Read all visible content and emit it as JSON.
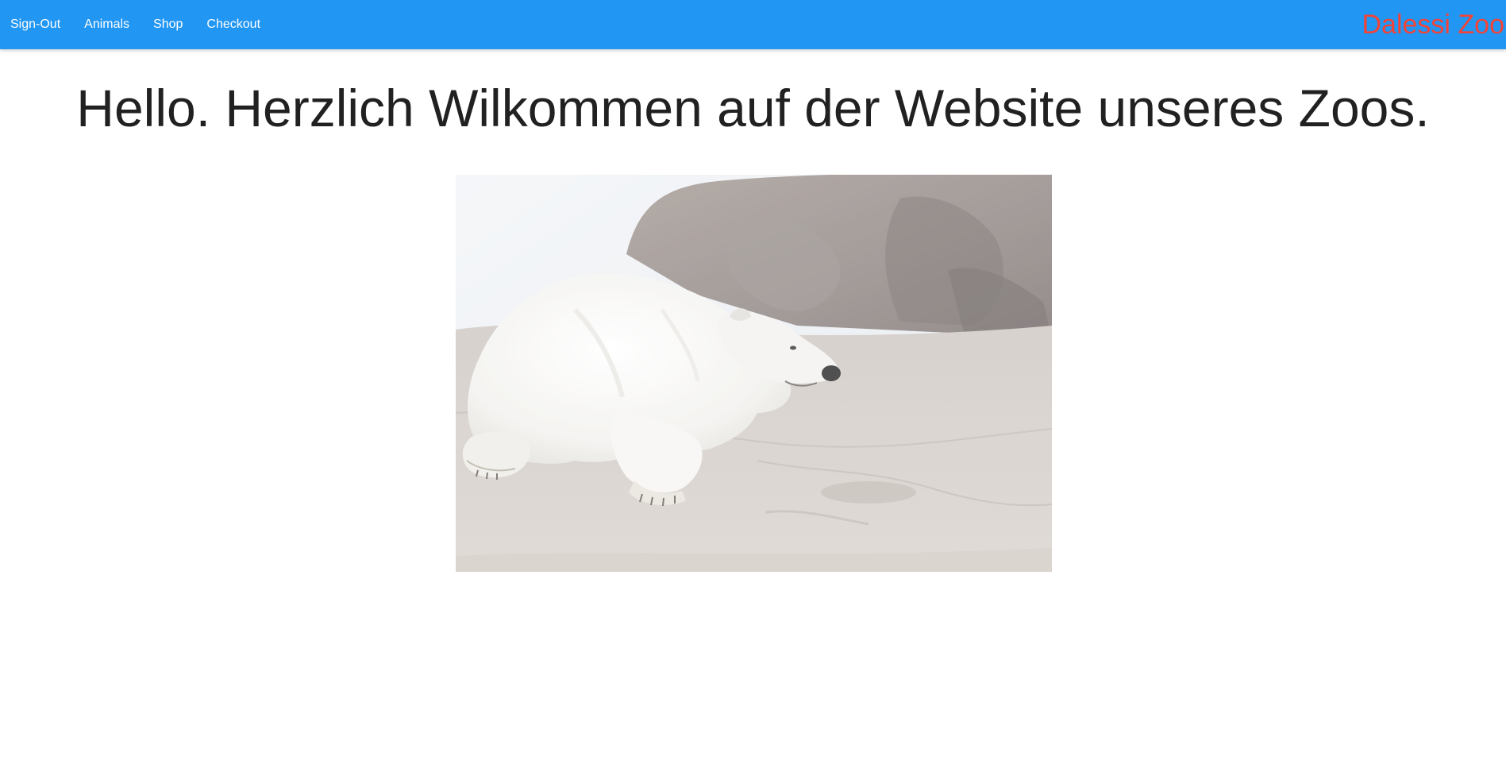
{
  "nav": {
    "links": [
      {
        "label": "Sign-Out"
      },
      {
        "label": "Animals"
      },
      {
        "label": "Shop"
      },
      {
        "label": "Checkout"
      }
    ],
    "brand": "Dalessi Zoo"
  },
  "main": {
    "heading": "Hello. Herzlich Wilkommen auf der Website unseres Zoos."
  },
  "colors": {
    "navbar": "#2196f3",
    "nav_text": "#ffffff",
    "brand": "#f44336",
    "heading": "#212121"
  }
}
